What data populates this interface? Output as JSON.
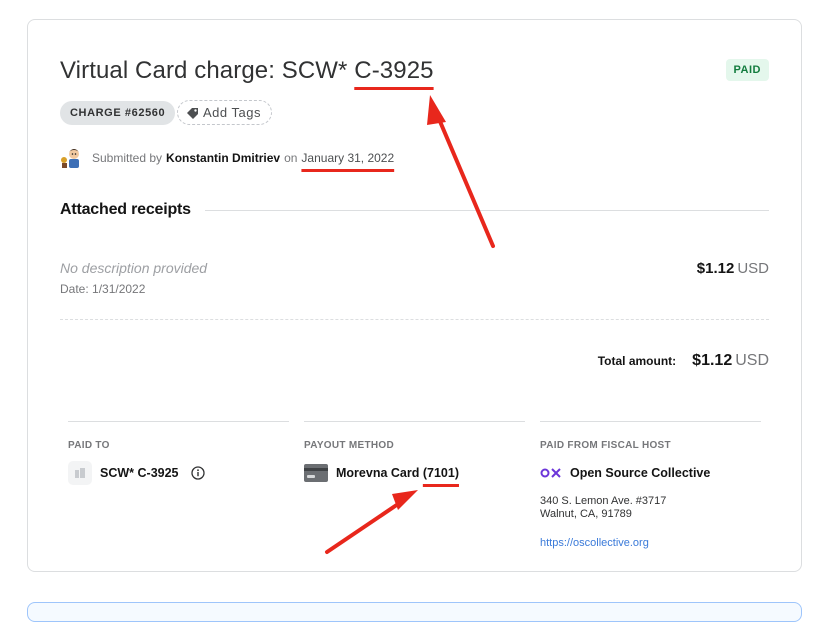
{
  "expense": {
    "title_prefix": "Virtual Card charge: SCW* ",
    "title_ref": "C-3925",
    "status": "PAID",
    "charge_tag": "CHARGE #62560",
    "add_tags_label": "Add Tags"
  },
  "submitted": {
    "prefix": "Submitted by",
    "name": "Konstantin Dmitriev",
    "on": "on",
    "date": "January 31, 2022"
  },
  "receipts": {
    "section_title": "Attached receipts",
    "item": {
      "description": "No description provided",
      "date": "Date: 1/31/2022",
      "amount": "$1.12",
      "currency": "USD"
    },
    "total_label": "Total amount:",
    "total_amount": "$1.12",
    "total_currency": "USD"
  },
  "paid_to": {
    "heading": "PAID TO",
    "name": "SCW* C-3925",
    "icon": "building-icon"
  },
  "payout_method": {
    "heading": "PAYOUT METHOD",
    "name": "Morevna Card",
    "ref": "(7101)",
    "icon": "credit-card-icon"
  },
  "fiscal_host": {
    "heading": "PAID FROM FISCAL HOST",
    "name": "Open Source Collective",
    "address_line1": "340 S. Lemon Ave. #3717",
    "address_line2": "Walnut, CA, 91789",
    "website": "https://oscollective.org",
    "icon": "oc-logo-icon"
  },
  "colors": {
    "annotation_red": "#e8271c",
    "paid_green": "#137c3e",
    "link_blue": "#3a7ad9"
  }
}
